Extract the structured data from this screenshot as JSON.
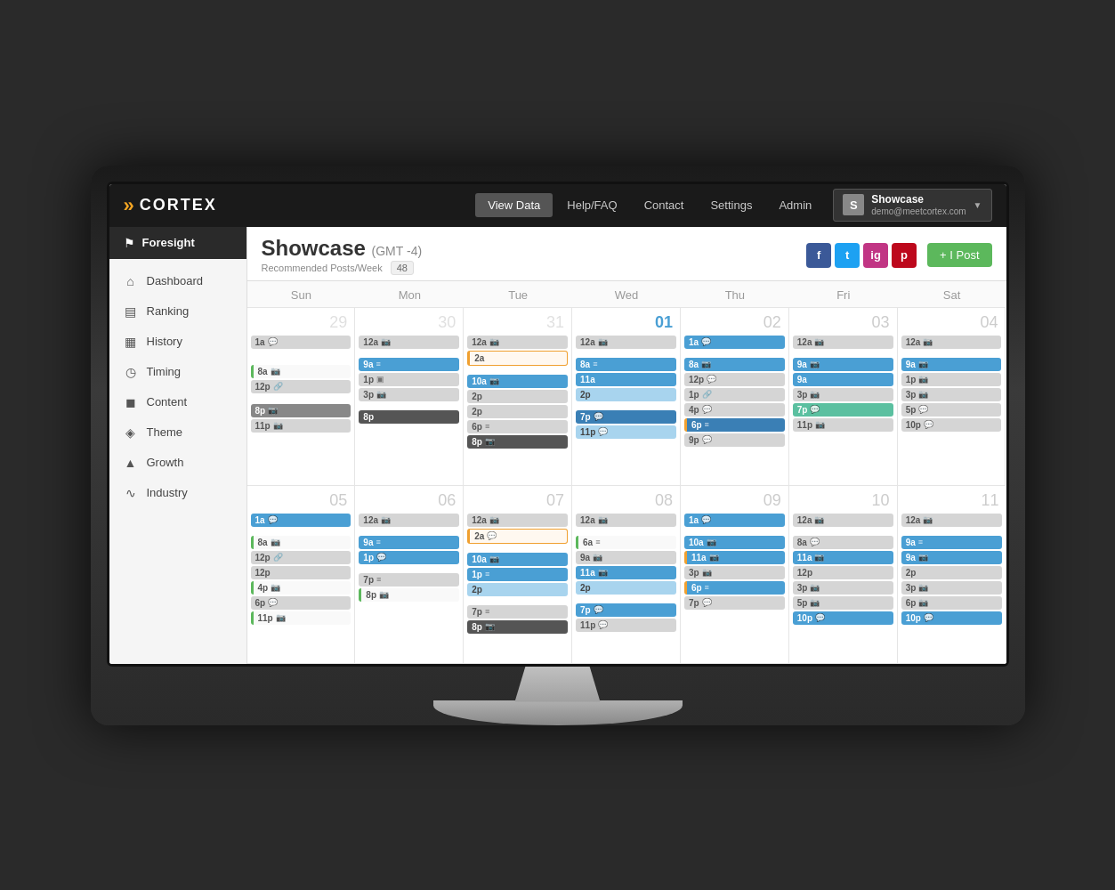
{
  "app": {
    "logo_arrows": "»",
    "logo_text": "CORTEX"
  },
  "nav": {
    "links": [
      "View Data",
      "Help/FAQ",
      "Contact",
      "Settings",
      "Admin"
    ],
    "active": "View Data"
  },
  "user": {
    "avatar_letter": "S",
    "name": "Showcase",
    "email": "demo@meetcortex.com"
  },
  "sidebar": {
    "foresight_label": "Foresight",
    "items": [
      {
        "label": "Dashboard",
        "icon": "⌂"
      },
      {
        "label": "Ranking",
        "icon": "▤"
      },
      {
        "label": "History",
        "icon": "▦"
      },
      {
        "label": "Timing",
        "icon": "◷"
      },
      {
        "label": "Content",
        "icon": "◼"
      },
      {
        "label": "Theme",
        "icon": "◈"
      },
      {
        "label": "Growth",
        "icon": "▲"
      },
      {
        "label": "Industry",
        "icon": "∿"
      }
    ]
  },
  "header": {
    "title": "Showcase",
    "subtitle_gmt": "(GMT -4)",
    "rec_label": "Recommended Posts/Week",
    "rec_value": "48",
    "post_button": "+ I Post"
  },
  "calendar": {
    "day_headers": [
      "Sun",
      "Mon",
      "Tue",
      "Wed",
      "Thu",
      "Fri",
      "Sat"
    ],
    "week1": {
      "days": [
        "29",
        "30",
        "31",
        "01",
        "02",
        "03",
        "04"
      ],
      "day_styles": [
        "prev",
        "prev",
        "prev",
        "today",
        "normal",
        "normal",
        "normal"
      ]
    },
    "week2": {
      "days": [
        "05",
        "06",
        "07",
        "08",
        "09",
        "10",
        "11"
      ]
    }
  },
  "colors": {
    "blue": "#4a9fd4",
    "light_blue": "#a8d4ee",
    "gray": "#d5d5d5",
    "green": "#5cb85c",
    "orange": "#f0a030",
    "dark": "#555"
  }
}
